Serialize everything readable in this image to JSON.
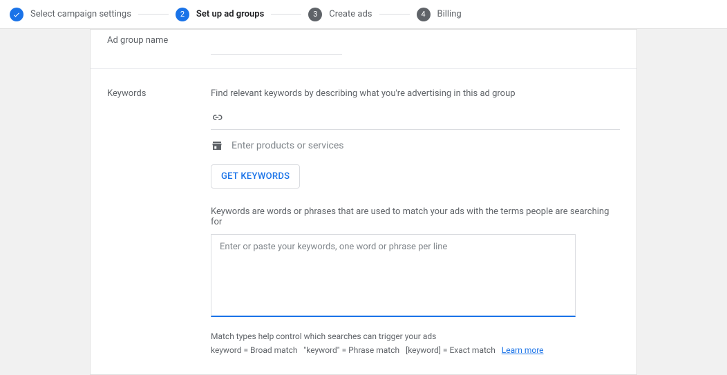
{
  "stepper": {
    "steps": [
      {
        "label": "Select campaign settings",
        "state": "done"
      },
      {
        "label": "Set up ad groups",
        "state": "active",
        "num": "2"
      },
      {
        "label": "Create ads",
        "state": "inactive",
        "num": "3"
      },
      {
        "label": "Billing",
        "state": "inactive",
        "num": "4"
      }
    ]
  },
  "sections": {
    "adgroup": {
      "label": "Ad group name",
      "value": ""
    },
    "keywords": {
      "label": "Keywords",
      "intro": "Find relevant keywords by describing what you're advertising in this ad group",
      "url_placeholder": "",
      "products_placeholder": "Enter products or services",
      "get_button": "GET KEYWORDS",
      "explain": "Keywords are words or phrases that are used to match your ads with the terms people are searching for",
      "textarea_placeholder": "Enter or paste your keywords, one word or phrase per line",
      "match_line1": "Match types help control which searches can trigger your ads",
      "match_broad": "keyword = Broad match",
      "match_phrase": "\"keyword\" = Phrase match",
      "match_exact": "[keyword] = Exact match",
      "learn_more": "Learn more"
    }
  }
}
